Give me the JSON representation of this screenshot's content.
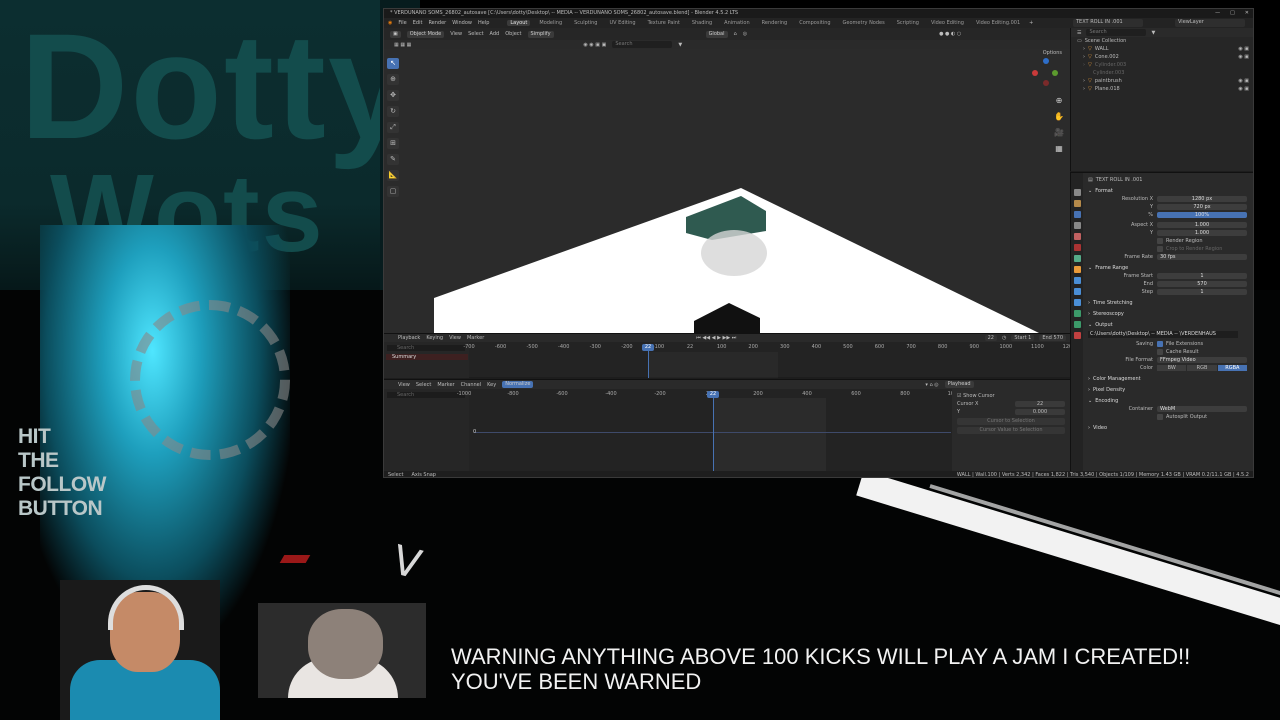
{
  "overlay": {
    "name_line1": "Dotty",
    "name_line2": "Wots",
    "hit_follow": [
      "HIT",
      "THE",
      "FOLLOW",
      "BUTTON"
    ],
    "warning_line1": "WARNING ANYTHING ABOVE 100 KICKS WILL PLAY A JAM I CREATED!!",
    "warning_line2": "YOU'VE BEEN WARNED"
  },
  "blender": {
    "title": "* VERDUNANO SOMS_26802_autosave [C:\\Users\\dotty\\Desktop\\ -- MEDIA -- VERDUNANO SOMS_26802_autosave.blend] - Blender 4.5.2 LTS",
    "menu": [
      "File",
      "Edit",
      "Render",
      "Window",
      "Help"
    ],
    "workspaces": [
      "Layout",
      "Modeling",
      "Sculpting",
      "UV Editing",
      "Texture Paint",
      "Shading",
      "Animation",
      "Rendering",
      "Compositing",
      "Geometry Nodes",
      "Scripting",
      "Video Editing",
      "Video Editing.001"
    ],
    "active_workspace": "Layout",
    "scene_name": "TEXT ROLL IN .001",
    "view_layer": "ViewLayer",
    "viewport": {
      "mode": "Object Mode",
      "menus": [
        "View",
        "Select",
        "Add",
        "Object"
      ],
      "simplify": "Simplify",
      "orientation": "Global",
      "search_placeholder": "Search",
      "options": "Options"
    },
    "timeline": {
      "menus": [
        "Playback",
        "Keying",
        "View",
        "Marker"
      ],
      "search_placeholder": "Search",
      "summary": "Summary",
      "current_frame": "22",
      "start_label": "Start",
      "start": "1",
      "end_label": "End",
      "end": "570",
      "ruler": [
        "-700",
        "-600",
        "-500",
        "-400",
        "-300",
        "-200",
        "-100",
        "22",
        "100",
        "200",
        "300",
        "400",
        "500",
        "600",
        "700",
        "800",
        "900",
        "1000",
        "1100",
        "1200"
      ]
    },
    "graph": {
      "menus": [
        "View",
        "Select",
        "Marker",
        "Channel",
        "Key"
      ],
      "normalize": "Normalize",
      "playhead": "Playhead",
      "search_placeholder": "Search",
      "zero": "0",
      "ruler": [
        "-1000",
        "-800",
        "-600",
        "-400",
        "-200",
        "22",
        "200",
        "400",
        "600",
        "800",
        "1000"
      ],
      "show_cursor": "Show Cursor",
      "cursor_x_label": "Cursor X",
      "cursor_x": "22",
      "cursor_y_label": "Y",
      "cursor_y": "0.000",
      "btn1": "Cursor to Selection",
      "btn2": "Cursor Value to Selection"
    },
    "status": {
      "left1": "Select",
      "left2": "Axis Snap",
      "right": "WALL | Wall.100 | Verts 2,342 | Faces 1,822 | Tris 3,540 | Objects 1/109 | Memory 1.43 GB | VRAM 0.2/11.1 GB | 4.5.2"
    },
    "outliner": {
      "search_placeholder": "Search",
      "rows": [
        {
          "name": "Scene Collection",
          "indent": 0,
          "dim": false
        },
        {
          "name": "WALL",
          "indent": 1,
          "dim": false
        },
        {
          "name": "Cone.002",
          "indent": 1,
          "dim": false
        },
        {
          "name": "Cylinder.003",
          "indent": 1,
          "dim": true
        },
        {
          "name": "Cylinder.003",
          "indent": 2,
          "dim": true
        },
        {
          "name": "paintbrush",
          "indent": 1,
          "dim": false
        },
        {
          "name": "Plane.018",
          "indent": 1,
          "dim": false
        }
      ]
    },
    "properties": {
      "scene": "TEXT ROLL IN .001",
      "format": "Format",
      "res_x_label": "Resolution X",
      "res_x": "1280 px",
      "res_y_label": "Y",
      "res_y": "720 px",
      "res_pct_label": "%",
      "res_pct": "100%",
      "aspect_x_label": "Aspect X",
      "aspect_x": "1.000",
      "aspect_y_label": "Y",
      "aspect_y": "1.000",
      "render_region": "Render Region",
      "crop": "Crop to Render Region",
      "frame_rate_label": "Frame Rate",
      "frame_rate": "30 fps",
      "frame_range": "Frame Range",
      "frame_start_label": "Frame Start",
      "frame_start": "1",
      "end_label": "End",
      "end": "570",
      "step_label": "Step",
      "step": "1",
      "time_stretching": "Time Stretching",
      "stereoscopy": "Stereoscopy",
      "output": "Output",
      "output_path": "C:\\Users\\dotty\\Desktop\\ -- MEDIA -- \\VERDENHAUS",
      "saving_label": "Saving",
      "file_extensions": "File Extensions",
      "cache_result": "Cache Result",
      "file_format_label": "File Format",
      "file_format": "FFmpeg Video",
      "color_label": "Color",
      "color_opts": [
        "BW",
        "RGB",
        "RGBA"
      ],
      "color_management": "Color Management",
      "pixel_density": "Pixel Density",
      "encoding": "Encoding",
      "container_label": "Container",
      "container": "WebM",
      "autosplit": "Autosplit Output",
      "video": "Video"
    }
  },
  "colors": {
    "accent": "#4772b3",
    "teal_text": "#134c4c",
    "object_teal": "#2f5a50"
  }
}
